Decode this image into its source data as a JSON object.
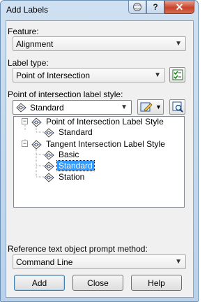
{
  "window": {
    "title": "Add Labels",
    "help_glyph": "?",
    "close_glyph": "✕"
  },
  "feature": {
    "label": "Feature:",
    "value": "Alignment"
  },
  "label_type": {
    "label": "Label type:",
    "value": "Point of Intersection"
  },
  "style": {
    "label": "Point of intersection label style:",
    "value": "Standard",
    "tree": [
      {
        "text": "Point of Intersection Label Style",
        "expander": "−"
      },
      {
        "text": "Standard"
      },
      {
        "text": "Tangent Intersection Label Style",
        "expander": "−"
      },
      {
        "text": "Basic"
      },
      {
        "text": "Standard",
        "selected": true
      },
      {
        "text": "Station"
      }
    ]
  },
  "prompt_method": {
    "label": "Reference text object prompt method:",
    "value": "Command Line"
  },
  "buttons": {
    "add": "Add",
    "close": "Close",
    "help": "Help"
  },
  "icons": [
    "ball-icon",
    "help-icon",
    "close-icon",
    "checklist-icon",
    "edit-style-icon",
    "preview-icon",
    "label-style-icon"
  ],
  "colors": {
    "selection": "#3399ff",
    "title_bg": "#b9d1ea",
    "close_button": "#c7432b"
  }
}
